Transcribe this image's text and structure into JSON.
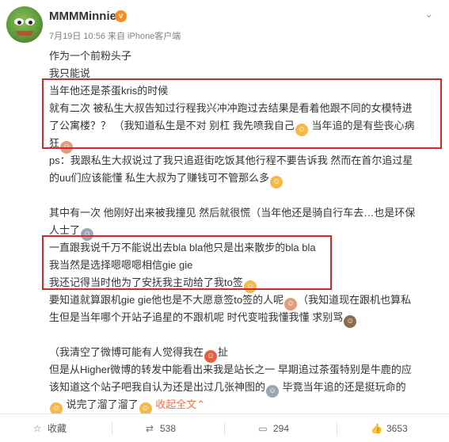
{
  "post": {
    "username": "MMMMinnie",
    "badge_icon": "vip-badge-icon",
    "meta": "7月19日 10:56 来自 iPhone客户端",
    "more_icon": "chevron-down-icon"
  },
  "content": {
    "l1": "作为一个前粉头子",
    "l2": "我只能说",
    "l3": "当年他还是茶蛋kris的时候",
    "l4": "就有二次 被私生大叔告知过行程我兴冲冲跑过去结果是看着他跟不同的女模特进",
    "l5": "了公寓楼？？  （我知道私生是不对 别杠 我先喷我自己",
    "l5b": "  当年追的是有些丧心病",
    "l6": "狂",
    "l7": "ps：我跟私生大叔说过了我只追逛街吃饭其他行程不要告诉我 然而在首尔追过星",
    "l8": "的uu们应该能懂 私生大叔为了赚钱可不管那么多",
    "l9": "其中有一次 他刚好出来被我撞见 然后就很慌（当年他还是骑自行车去…也是环保",
    "l10": "人士了",
    "l11": "一直跟我说千万不能说出去bla bla他只是出来散步的bla bla",
    "l12": "我当然是选择嗯嗯嗯相信gie gie",
    "l13": "我还记得当时他为了安抚我主动给了我to签",
    "l14": "要知道就算跟机gie gie他也是不大愿意签to签的人呢",
    "l14b": "（我知道现在跟机也算私",
    "l15": "生但是当年哪个开站子追星的不跟机呢 时代变啦我懂我懂 求别骂",
    "l16": "（我清空了微博可能有人觉得我在",
    "l16b": "扯",
    "l17": "但是从Higher微博的转发中能看出来我是站长之一 早期追过茶蛋特别是牛鹿的应",
    "l18": "该知道这个站子吧我自认为还是出过几张神图的",
    "l18b": " 毕竟当年追的还是挺玩命的",
    "l19": " 说完了溜了溜了",
    "collapse": "收起全文",
    "collapse_icon": "chevron-up-icon"
  },
  "footer": {
    "favorite_icon": "star-icon",
    "favorite_label": "收藏",
    "repost_icon": "repost-icon",
    "repost_count": "538",
    "comment_icon": "comment-icon",
    "comment_count": "294",
    "like_icon": "thumbs-up-icon",
    "like_count": "3653"
  },
  "colors": {
    "highlight_box": "#d9262b",
    "link": "#eb7350",
    "text": "#333333",
    "meta": "#808080"
  }
}
